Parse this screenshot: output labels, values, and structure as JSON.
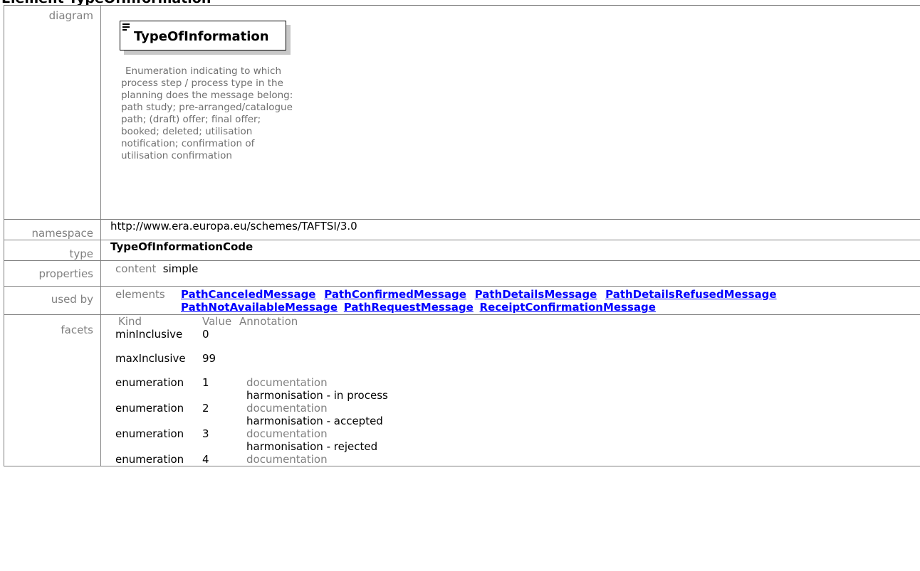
{
  "page_title": "Element TypeOfInformation",
  "labels": {
    "diagram": "diagram",
    "namespace": "namespace",
    "type": "type",
    "properties": "properties",
    "used_by": "used by",
    "facets": "facets"
  },
  "diagram": {
    "node_title": "TypeOfInformation",
    "description": "Enumeration indicating to which process step / process type in the planning does the message belong: path study; pre-arranged/catalogue path; (draft) offer; final offer; booked; deleted; utilisation notification; confirmation of utilisation confirmation"
  },
  "namespace": "http://www.era.europa.eu/schemes/TAFTSI/3.0",
  "type": "TypeOfInformationCode",
  "properties": {
    "label": "content",
    "value": "simple"
  },
  "used_by": {
    "label": "elements",
    "links": [
      "PathCanceledMessage",
      "PathConfirmedMessage",
      "PathDetailsMessage",
      "PathDetailsRefusedMessage",
      "PathNotAvailableMessage",
      "PathRequestMessage",
      "ReceiptConfirmationMessage"
    ]
  },
  "facets": {
    "headers": [
      "Kind",
      "Value",
      "Annotation"
    ],
    "rows": [
      {
        "kind": "minInclusive",
        "value": "0",
        "annotation_label": "",
        "annotation": ""
      },
      {
        "kind": "maxInclusive",
        "value": "99",
        "annotation_label": "",
        "annotation": ""
      },
      {
        "kind": "enumeration",
        "value": "1",
        "annotation_label": "documentation",
        "annotation": "harmonisation - in process"
      },
      {
        "kind": "enumeration",
        "value": "2",
        "annotation_label": "documentation",
        "annotation": "harmonisation - accepted"
      },
      {
        "kind": "enumeration",
        "value": "3",
        "annotation_label": "documentation",
        "annotation": "harmonisation - rejected"
      },
      {
        "kind": "enumeration",
        "value": "4",
        "annotation_label": "documentation",
        "annotation": ""
      }
    ]
  }
}
